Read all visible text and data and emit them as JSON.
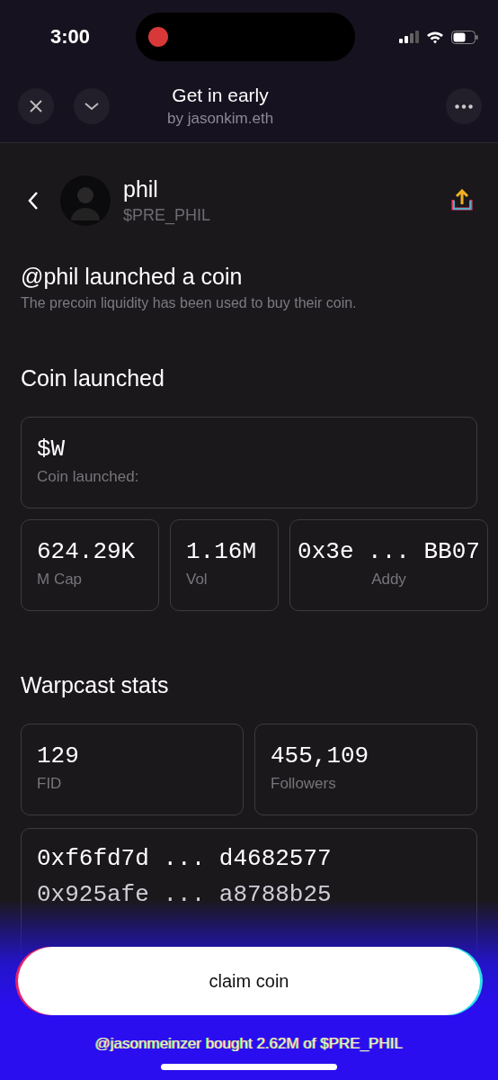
{
  "status_bar": {
    "time": "3:00"
  },
  "header": {
    "title": "Get in early",
    "subtitle": "by jasonkim.eth"
  },
  "profile": {
    "name": "phil",
    "handle": "$PRE_PHIL"
  },
  "headline": "@phil launched a coin",
  "description": "The precoin liquidity has been used to buy their coin.",
  "coin_section": {
    "title": "Coin launched",
    "symbol": "$W",
    "symbol_label": "Coin launched:",
    "stats": [
      {
        "kind": "metric",
        "value": "624.29K",
        "label": "M Cap"
      },
      {
        "kind": "metric",
        "value": "1.16M",
        "label": "Vol"
      },
      {
        "kind": "address",
        "value": "0x3e ... BB07",
        "label": "Addy"
      }
    ]
  },
  "warpcast_section": {
    "title": "Warpcast stats",
    "stats": [
      {
        "value": "129",
        "label": "FID"
      },
      {
        "value": "455,109",
        "label": "Followers"
      }
    ],
    "addresses": [
      "0xf6fd7d ... d4682577",
      "0x925afe ... a8788b25"
    ]
  },
  "claim_button": "claim coin",
  "activity": "@jasonmeinzer bought 2.62M of $PRE_PHIL"
}
